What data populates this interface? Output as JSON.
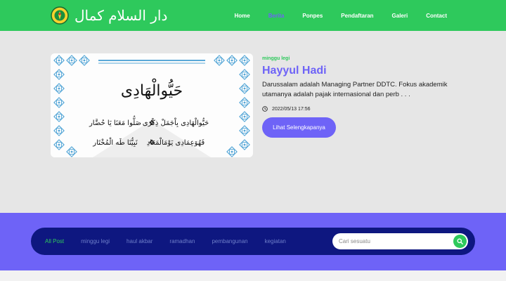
{
  "brand": {
    "logo_text": "دار السلام كمال"
  },
  "nav": {
    "items": [
      {
        "label": "Home",
        "active": false
      },
      {
        "label": "Berita",
        "active": true
      },
      {
        "label": "Ponpes",
        "active": false
      },
      {
        "label": "Pendaftaran",
        "active": false
      },
      {
        "label": "Galeri",
        "active": false
      },
      {
        "label": "Contact",
        "active": false
      }
    ]
  },
  "post": {
    "image_heading": "حَيُّوالْهَادِى",
    "image_line1_right": "حَيُّوالْهَادِى بِاْجَمَلْ ذِكْرَى",
    "image_line1_left": "صَلُّوا مَعَنَا يَا حُضَّار",
    "image_line2_right": "فَهُوَعِمَادِى يَوْمَالْمَعَادِ",
    "image_line2_left": "نَبِيُّنَا طَه الْمُخْتَار",
    "category": "minggu legi",
    "title": "Hayyul Hadi",
    "excerpt": "Darussalam adalah Managing Partner DDTC. Fokus akademik utamanya adalah pajak internasional dan perb . . .",
    "date": "2022/05/13 17:56",
    "button_label": "Lihat Selengkapanya"
  },
  "filters": {
    "items": [
      {
        "label": "All Post",
        "active": true
      },
      {
        "label": "minggu legi",
        "active": false
      },
      {
        "label": "haul akbar",
        "active": false
      },
      {
        "label": "ramadhan",
        "active": false
      },
      {
        "label": "pembangunan",
        "active": false
      },
      {
        "label": "kegiatan",
        "active": false
      }
    ]
  },
  "search": {
    "placeholder": "Cari sesuatu"
  },
  "colors": {
    "primary_green": "#2ec95c",
    "primary_purple": "#6e63f7",
    "dark_navy": "#0e1780",
    "background": "#e6e6e6"
  }
}
